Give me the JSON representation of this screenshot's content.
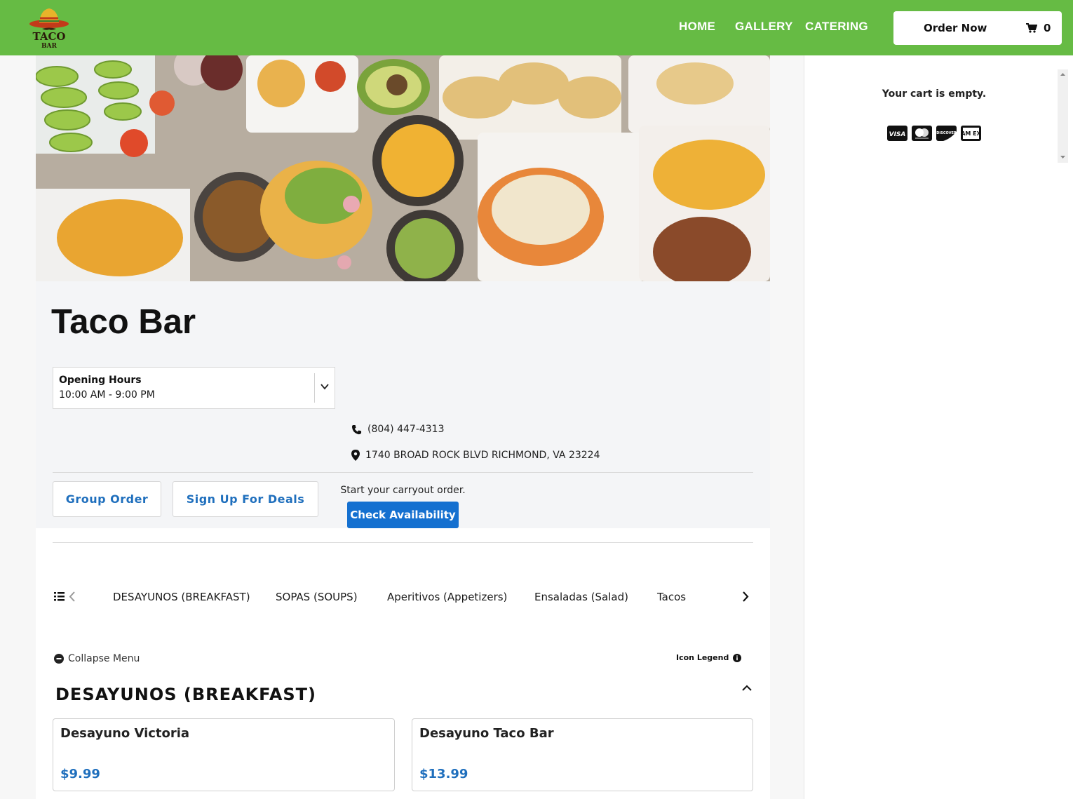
{
  "header": {
    "logo_text_top": "TACO",
    "logo_text_bottom": "BAR",
    "nav": [
      "HOME",
      "GALLERY",
      "CATERING"
    ],
    "order_label": "Order Now",
    "cart_count": "0",
    "bg_color": "#66bb44"
  },
  "restaurant": {
    "name": "Taco Bar",
    "hours_title": "Opening Hours",
    "hours_value": "10:00 AM - 9:00 PM",
    "phone": "(804) 447-4313",
    "address": "1740 BROAD ROCK BLVD RICHMOND, VA 23224",
    "group_order": "Group Order",
    "deals": "Sign Up For Deals"
  },
  "carryout": {
    "prompt": "Start your carryout order.",
    "button": "Check Availability"
  },
  "categories": [
    "DESAYUNOS (BREAKFAST)",
    "SOPAS (SOUPS)",
    "Aperitivos (Appetizers)",
    "Ensaladas (Salad)",
    "Tacos"
  ],
  "menu": {
    "collapse": "Collapse Menu",
    "legend": "Icon Legend",
    "section": "DESAYUNOS (BREAKFAST)",
    "items": [
      {
        "name": "Desayuno Victoria",
        "price": "$9.99"
      },
      {
        "name": "Desayuno Taco Bar",
        "price": "$13.99"
      }
    ]
  },
  "cart": {
    "empty": "Your cart is empty.",
    "payment_icons": [
      "visa-icon",
      "mastercard-icon",
      "discover-icon",
      "amex-icon"
    ],
    "visa": "VISA",
    "discover": "DISCOVER",
    "amex": "AM EX"
  }
}
